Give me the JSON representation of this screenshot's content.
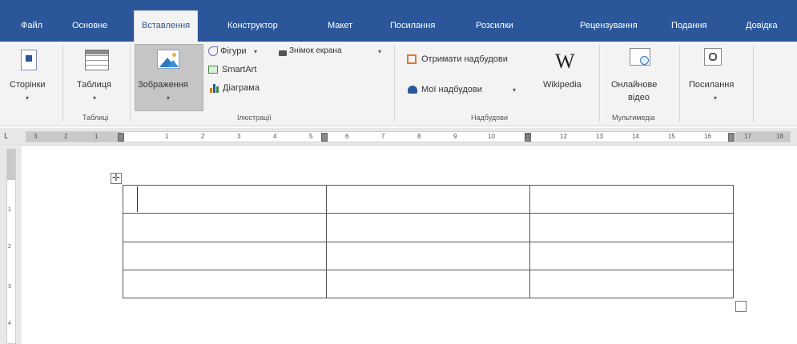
{
  "tabs": [
    {
      "label": "Файл"
    },
    {
      "label": "Основне"
    },
    {
      "label": "Вставлення"
    },
    {
      "label": "Конструктор"
    },
    {
      "label": "Макет"
    },
    {
      "label": "Посилання"
    },
    {
      "label": "Розсилки"
    },
    {
      "label": "Рецензування"
    },
    {
      "label": "Подання"
    },
    {
      "label": "Довідка"
    }
  ],
  "ribbon": {
    "pages": {
      "label": "Сторінки",
      "caret": "▾"
    },
    "table": {
      "label": "Таблиця",
      "caret": "▾",
      "group": "Таблиці"
    },
    "pictures": {
      "label": "Зображення",
      "caret": "▾"
    },
    "shapes": {
      "label": "Фігури",
      "caret": "▾"
    },
    "screenshot": {
      "label": "Знімок екрана",
      "caret": "▾"
    },
    "smartart": {
      "label": "SmartArt"
    },
    "chart": {
      "label": "Діаграма"
    },
    "illustrations_group": "Ілюстрації",
    "get_addins": {
      "label": "Отримати надбудови"
    },
    "my_addins": {
      "label": "Мої надбудови",
      "caret": "▾"
    },
    "wikipedia": {
      "label": "Wikipedia",
      "logo": "W"
    },
    "addins_group": "Надбудови",
    "online_video": {
      "label_line1": "Онлайнове",
      "label_line2": "відео"
    },
    "media_group": "Мультимедіа",
    "links": {
      "label": "Посилання",
      "caret": "▾"
    }
  },
  "ruler": {
    "numbers": [
      "3",
      "2",
      "1",
      "1",
      "2",
      "3",
      "4",
      "5",
      "6",
      "7",
      "8",
      "9",
      "10",
      "11",
      "12",
      "13",
      "14",
      "15",
      "16",
      "17",
      "18"
    ],
    "tab_selector": "L"
  },
  "vruler": {
    "numbers": [
      "1",
      "2",
      "3",
      "4"
    ]
  },
  "table": {
    "rows": 4,
    "cols": 3,
    "move_glyph": "✛"
  },
  "colors": {
    "accent": "#2b579a",
    "ribbon": "#f3f3f3"
  }
}
